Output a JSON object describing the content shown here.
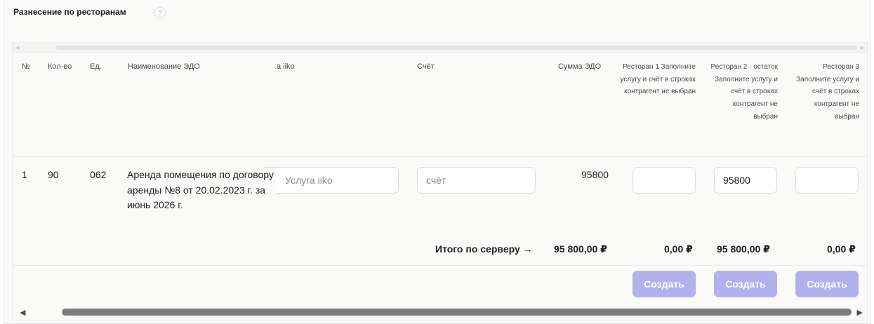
{
  "section": {
    "title": "Разнесение по ресторанам",
    "help_icon": "question-icon",
    "help_glyph": "?"
  },
  "table": {
    "headers": {
      "num": "№",
      "qty": "Кол-во",
      "unit": "Ед.",
      "name": "Наименование ЭДО",
      "service": "а iiko",
      "account": "Счёт",
      "sum": "Сумма ЭДО",
      "rest1": "Ресторан 1 Заполните услугу и счёт в строках контрагент не выбран",
      "rest2": "Ресторан 2 · остаток Заполните услугу и счёт в строках контрагент не выбран",
      "rest3": "Ресторан 3 Заполните услугу и счёт в строках контрагент не выбран"
    },
    "rows": [
      {
        "num": "1",
        "qty": "90",
        "unit": "062",
        "name": "Аренда помещения по договору аренды №8 от 20.02.2023 г. за июнь 2026 г.",
        "service_placeholder": "Услуга iiko",
        "account_placeholder": "счёт",
        "sum": "95800",
        "rest1_value": "",
        "rest2_value": "95800",
        "rest3_value": ""
      }
    ],
    "totals": {
      "label": "Итого по серверу →",
      "sum": "95 800,00 ₽",
      "rest1": "0,00 ₽",
      "rest2": "95 800,00 ₽",
      "rest3": "0,00 ₽"
    },
    "create_label": "Создать"
  },
  "colors": {
    "button_bg": "#b3b0ee",
    "panel_bg": "#fafaf9"
  }
}
